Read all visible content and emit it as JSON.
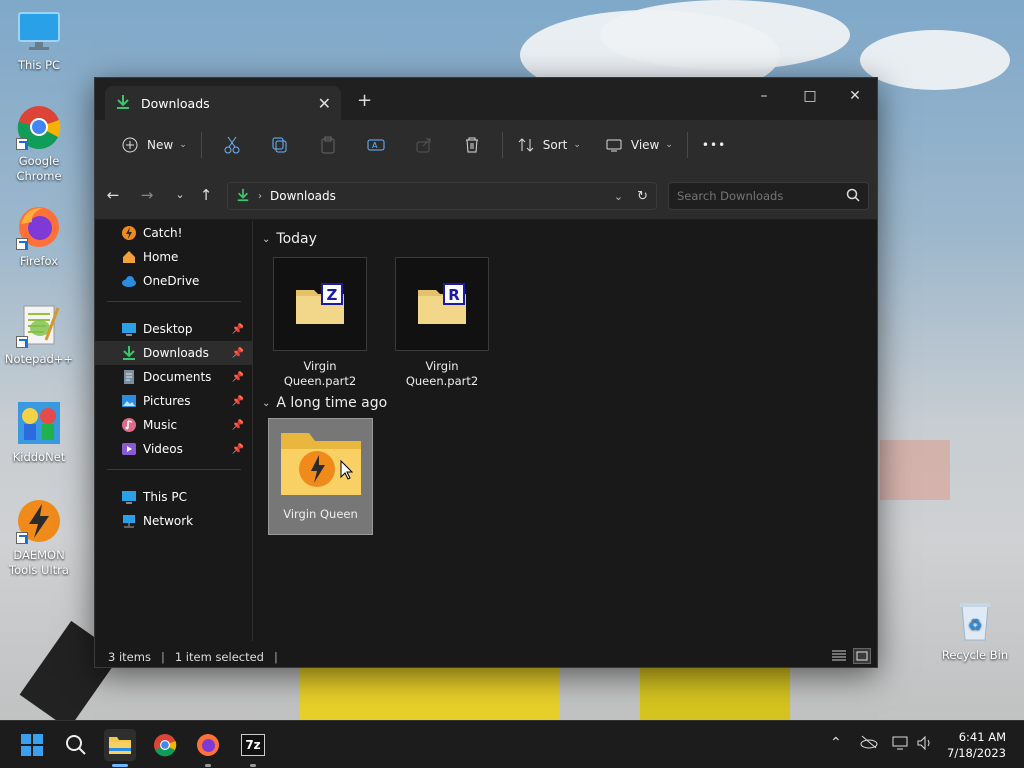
{
  "desktop": {
    "icons": [
      {
        "label": "This PC"
      },
      {
        "label": "Google Chrome"
      },
      {
        "label": "Firefox"
      },
      {
        "label": "Notepad++"
      },
      {
        "label": "KiddoNet"
      },
      {
        "label": "DAEMON Tools Ultra"
      },
      {
        "label": "Recycle Bin"
      }
    ]
  },
  "window": {
    "tab_title": "Downloads",
    "controls": {
      "minimize": "–",
      "maximize": "□",
      "close": "✕"
    },
    "toolbar": {
      "new_label": "New",
      "sort_label": "Sort",
      "view_label": "View",
      "more_label": "•••"
    },
    "address": {
      "path": "Downloads"
    },
    "search": {
      "placeholder": "Search Downloads"
    },
    "sidebar": {
      "quick": [
        {
          "label": "Catch!"
        },
        {
          "label": "Home"
        },
        {
          "label": "OneDrive"
        }
      ],
      "pinned": [
        {
          "label": "Desktop"
        },
        {
          "label": "Downloads"
        },
        {
          "label": "Documents"
        },
        {
          "label": "Pictures"
        },
        {
          "label": "Music"
        },
        {
          "label": "Videos"
        }
      ],
      "devices": [
        {
          "label": "This PC"
        },
        {
          "label": "Network"
        }
      ]
    },
    "groups": [
      {
        "header": "Today",
        "files": [
          {
            "name_line1": "Virgin",
            "name_line2": "Queen.part2",
            "badge": "Z"
          },
          {
            "name_line1": "Virgin",
            "name_line2": "Queen.part2",
            "badge": "R"
          }
        ]
      },
      {
        "header": "A long time ago",
        "files": [
          {
            "name_line1": "Virgin Queen",
            "name_line2": ""
          }
        ]
      }
    ],
    "status": {
      "count": "3 items",
      "selected": "1 item selected"
    }
  },
  "taskbar": {
    "clock_time": "6:41 AM",
    "clock_date": "7/18/2023",
    "sevenzip_label": "7z"
  },
  "colors": {
    "accent": "#0067c0",
    "folder": "#f2c94c",
    "download_green": "#3ec46d"
  }
}
